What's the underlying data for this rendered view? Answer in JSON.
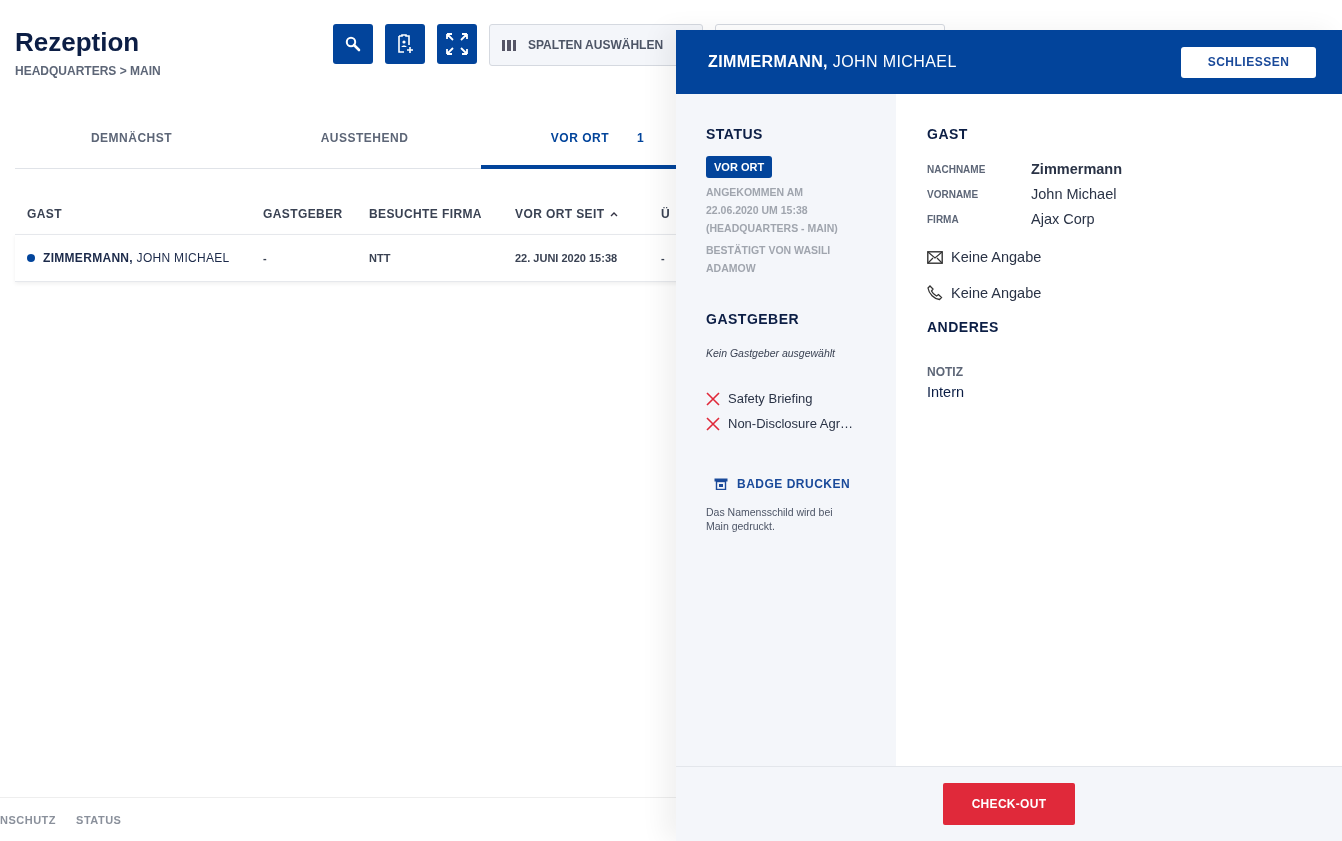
{
  "page": {
    "title": "Rezeption",
    "breadcrumb": "HEADQUARTERS > MAIN",
    "columns_button": "SPALTEN AUSWÄHLEN"
  },
  "tabs": [
    {
      "label": "DEMNÄCHST",
      "selected": false
    },
    {
      "label": "AUSSTEHEND",
      "selected": false
    },
    {
      "label": "VOR ORT",
      "count": "1",
      "selected": true
    }
  ],
  "table": {
    "columns": [
      {
        "label": "GAST",
        "sorted": false
      },
      {
        "label": "GASTGEBER",
        "sorted": false
      },
      {
        "label": "BESUCHTE FIRMA",
        "sorted": false
      },
      {
        "label": "VOR ORT SEIT",
        "sorted": true
      },
      {
        "label": "Ü",
        "sorted": false
      }
    ],
    "rows": [
      {
        "color": "#02449b",
        "cells": [
          "**ZIMMERMANN,** JOHN MICHAEL",
          "-",
          "NTT",
          "22. JUNI 2020 15:38",
          "-"
        ]
      }
    ]
  },
  "footer_links": [
    "NSCHUTZ",
    "STATUS"
  ],
  "panel": {
    "title": "**ZIMMERMANN,** JOHN MICHAEL",
    "close": "SCHLIESSEN",
    "status": {
      "heading": "STATUS",
      "badge": "VOR ORT",
      "arrived": "ANGEKOMMEN AM 22.06.2020 UM 15:38 (HEADQUARTERS - MAIN)",
      "confirmed": "BESTÄTIGT VON WASILI ADAMOW"
    },
    "host": {
      "heading": "GASTGEBER",
      "empty": "Kein Gastgeber ausgewählt"
    },
    "checklist": [
      {
        "label": "Safety Briefing",
        "done": false
      },
      {
        "label": "Non-Disclosure Agr…",
        "done": false
      }
    ],
    "badge": {
      "action": "BADGE DRUCKEN",
      "note": "Das Namensschild wird bei Main gedruckt."
    },
    "guest": {
      "heading": "GAST",
      "fields": [
        {
          "label": "NACHNAME",
          "value": "Zimmermann",
          "emphasis": true
        },
        {
          "label": "VORNAME",
          "value": "John Michael",
          "emphasis": false
        },
        {
          "label": "FIRMA",
          "value": "Ajax Corp",
          "emphasis": false
        }
      ],
      "contacts": [
        {
          "kind": "email",
          "value": "Keine Angabe"
        },
        {
          "kind": "phone",
          "value": "Keine Angabe"
        }
      ]
    },
    "other": {
      "heading": "ANDERES",
      "note_label": "NOTIZ",
      "note": "Intern"
    },
    "checkout": "CHECK-OUT"
  }
}
